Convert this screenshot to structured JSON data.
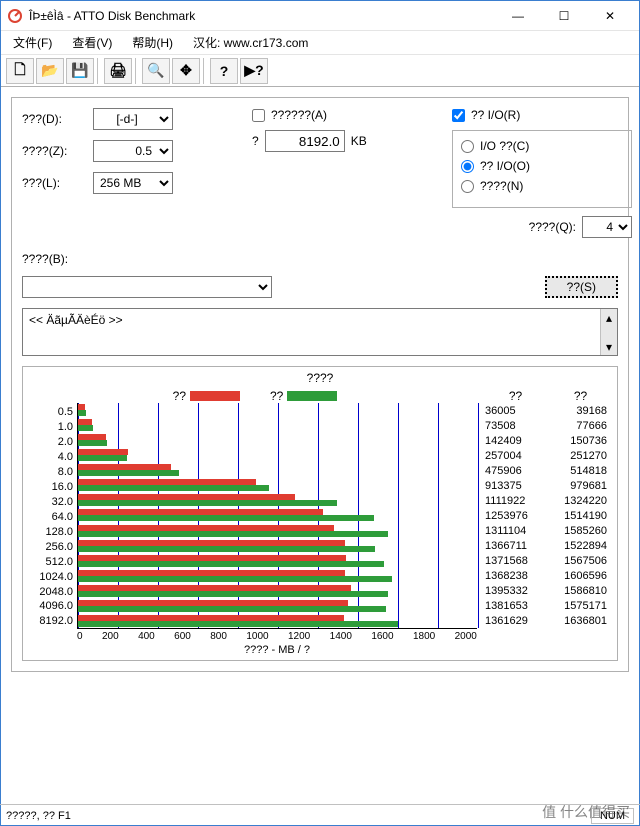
{
  "window": {
    "title": "ÎÞ±êÌâ - ATTO Disk Benchmark",
    "minimize": "—",
    "maximize": "☐",
    "close": "✕"
  },
  "menu": {
    "file": "文件(F)",
    "view": "查看(V)",
    "help": "帮助(H)",
    "credit": "汉化: www.cr173.com"
  },
  "toolbar": {
    "new": "🗋",
    "open": "📂",
    "save": "💾",
    "print": "🖨",
    "preview": "🔍",
    "start": "✥",
    "help": "?",
    "context": "▶?"
  },
  "config": {
    "drive_label": "???(D):",
    "drive_value": "[-d-]",
    "size_label": "????(Z):",
    "size_value": "0.5",
    "size_sep": "?",
    "size_max": "8192.0",
    "size_unit": "KB",
    "length_label": "???(L):",
    "length_value": "256 MB",
    "direct_checkbox": "??????(A)",
    "io_checkbox": "?? I/O(R)",
    "io_radio1": "I/O ??(C)",
    "io_radio2": "?? I/O(O)",
    "io_radio3": "????(N)",
    "queue_label": "????(Q):",
    "queue_value": "4",
    "desc_label": "????(B):",
    "desc_value": "",
    "run_button": "??(S)",
    "log_text": "<< ÄãµÃÄèÉö >>"
  },
  "chart_data": {
    "type": "bar",
    "title": "????",
    "xlabel": "???? - MB / ?",
    "xlim": [
      0,
      2000
    ],
    "xticks": [
      0,
      200,
      400,
      600,
      800,
      1000,
      1200,
      1400,
      1600,
      1800,
      2000
    ],
    "legend": {
      "write": "??",
      "read": "??"
    },
    "num_header": {
      "write": "??",
      "read": "??"
    },
    "categories": [
      "0.5",
      "1.0",
      "2.0",
      "4.0",
      "8.0",
      "16.0",
      "32.0",
      "64.0",
      "128.0",
      "256.0",
      "512.0",
      "1024.0",
      "2048.0",
      "4096.0",
      "8192.0"
    ],
    "series": [
      {
        "name": "write",
        "color": "#e03c31",
        "values_kb": [
          36005,
          73508,
          142409,
          257004,
          475906,
          913375,
          1111922,
          1253976,
          1311104,
          1366711,
          1371568,
          1368238,
          1395332,
          1381653,
          1361629
        ]
      },
      {
        "name": "read",
        "color": "#2e9c3a",
        "values_kb": [
          39168,
          77666,
          150736,
          251270,
          514818,
          979681,
          1324220,
          1514190,
          1585260,
          1522894,
          1567506,
          1606596,
          1586810,
          1575171,
          1636801
        ]
      }
    ]
  },
  "status": {
    "hint": "?????, ?? F1",
    "num": "NUM"
  },
  "watermark": "值 什么值得买"
}
